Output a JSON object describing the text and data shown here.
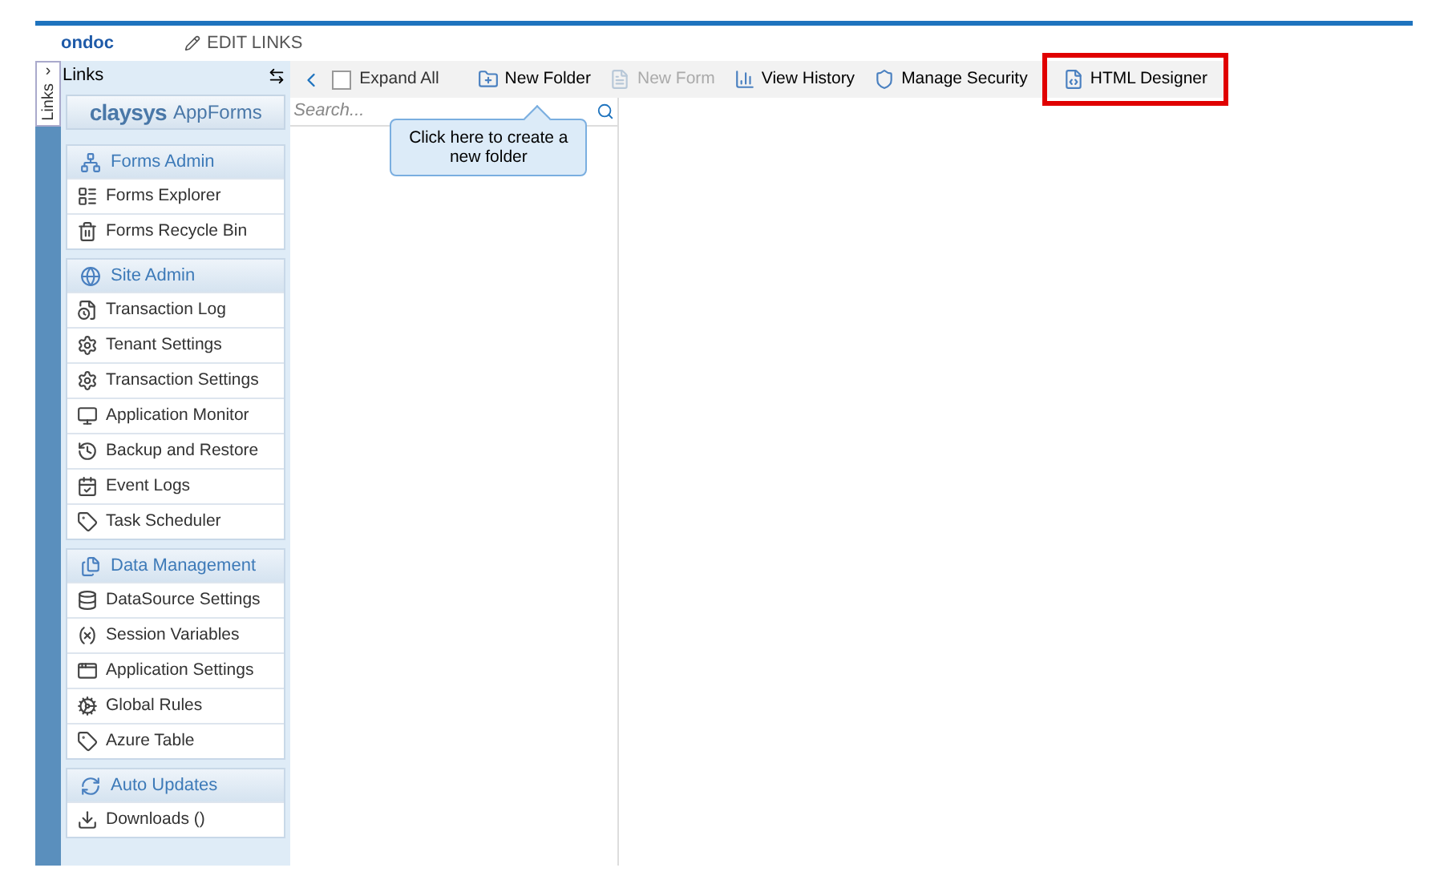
{
  "header": {
    "brand": "ondoc",
    "edit_link": "EDIT LINKS"
  },
  "side_tab": {
    "label": "Links",
    "arrow": "›"
  },
  "sidebar": {
    "title": "Links",
    "logo_word": "claysys",
    "logo_product": "AppForms",
    "groups": [
      {
        "title": "Forms Admin",
        "items": [
          {
            "label": "Forms Explorer"
          },
          {
            "label": "Forms Recycle Bin"
          }
        ]
      },
      {
        "title": "Site Admin",
        "items": [
          {
            "label": "Transaction Log"
          },
          {
            "label": "Tenant Settings"
          },
          {
            "label": "Transaction Settings"
          },
          {
            "label": "Application Monitor"
          },
          {
            "label": "Backup and Restore"
          },
          {
            "label": "Event Logs"
          },
          {
            "label": "Task Scheduler"
          }
        ]
      },
      {
        "title": "Data Management",
        "items": [
          {
            "label": "DataSource Settings"
          },
          {
            "label": "Session Variables"
          },
          {
            "label": "Application Settings"
          },
          {
            "label": "Global Rules"
          },
          {
            "label": "Azure Table"
          }
        ]
      },
      {
        "title": "Auto Updates",
        "items": [
          {
            "label": "Downloads ()"
          }
        ]
      }
    ]
  },
  "toolbar": {
    "expand_all": {
      "label": "Expand All",
      "checked": false
    },
    "buttons": [
      {
        "label": "New Folder",
        "disabled": false,
        "highlighted": false
      },
      {
        "label": "New Form",
        "disabled": true,
        "highlighted": false
      },
      {
        "label": "View History",
        "disabled": false,
        "highlighted": false
      },
      {
        "label": "Manage Security",
        "disabled": false,
        "highlighted": false
      },
      {
        "label": "HTML Designer",
        "disabled": false,
        "highlighted": true
      }
    ]
  },
  "search": {
    "placeholder": "Search..."
  },
  "tooltip": {
    "text": "Click here to create a new folder"
  }
}
